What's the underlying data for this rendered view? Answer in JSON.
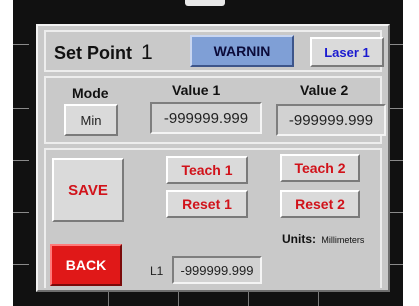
{
  "header": {
    "title_label": "Set Point",
    "title_number": "1",
    "warning_label": "WARNIN",
    "laser_label": "Laser 1"
  },
  "values_section": {
    "mode_label": "Mode",
    "mode_value": "Min",
    "value1_label": "Value 1",
    "value1": "-999999.999",
    "value2_label": "Value 2",
    "value2": "-999999.999"
  },
  "actions": {
    "save_label": "SAVE",
    "teach1_label": "Teach 1",
    "reset1_label": "Reset 1",
    "teach2_label": "Teach 2",
    "reset2_label": "Reset 2",
    "units_label": "Units:",
    "units_value": "Millimeters",
    "back_label": "BACK",
    "l1_label": "L1",
    "l1_value": "-999999.999"
  },
  "colors": {
    "accent_red": "#d1121a",
    "warning_blue": "#7f9fd6",
    "laser_text": "#1a1ad0"
  }
}
